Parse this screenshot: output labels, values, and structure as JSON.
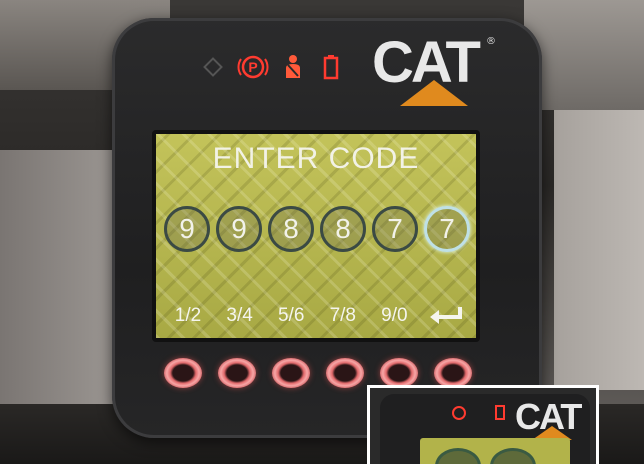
{
  "indicators": {
    "warning_icon": "diamond-warning-icon",
    "parking_icon": "parking-brake-icon",
    "parking_label": "P",
    "seatbelt_icon": "seatbelt-icon",
    "battery_icon": "battery-icon",
    "color_active": "#ff3b30"
  },
  "brand": {
    "logo_text": "CAT",
    "registered": "®",
    "accent_color": "#e08a1e"
  },
  "screen": {
    "title": "ENTER CODE",
    "digits": [
      "9",
      "9",
      "8",
      "8",
      "7",
      "7"
    ],
    "active_digit_index": 5,
    "softkeys": [
      "1/2",
      "3/4",
      "5/6",
      "7/8",
      "9/0"
    ],
    "enter_icon": "enter-return-icon"
  },
  "buttons": {
    "count": 6,
    "glow_color": "#ff6a6a"
  },
  "inset": {
    "logo_text": "CAT"
  }
}
